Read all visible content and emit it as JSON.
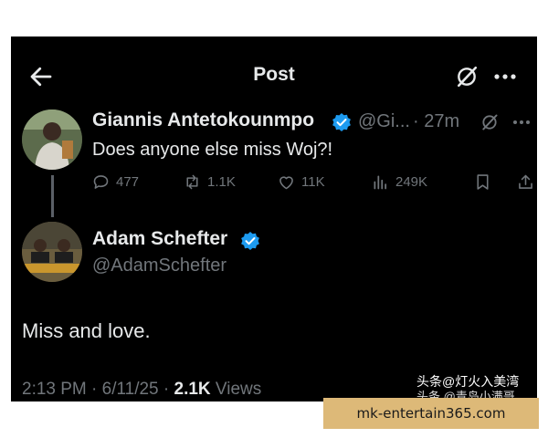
{
  "header": {
    "title": "Post",
    "back_icon": "arrow-left-icon",
    "grok_icon": "grok-icon",
    "more_icon": "more-horizontal-icon"
  },
  "original_post": {
    "author_name": "Giannis Antetokounmpo",
    "handle": "@Gi...",
    "time": "· 27m",
    "text": "Does anyone else miss Woj?!",
    "actions": {
      "replies": "477",
      "reposts": "1.1K",
      "likes": "11K",
      "views": "249K"
    }
  },
  "reply_post": {
    "author_name": "Adam Schefter",
    "handle": "@AdamSchefter",
    "text": "Miss and love.",
    "timestamp": "2:13 PM · 6/11/25 · ",
    "views_count": "2.1K",
    "views_label": " Views"
  },
  "watermark": {
    "line1": "头条@灯火入美湾",
    "line2": "头条 @青岛小满哥",
    "ad_text": "mk-entertain365.com"
  },
  "colors": {
    "background": "#000000",
    "text_primary": "#e7e9ea",
    "text_secondary": "#71767b",
    "verified_blue": "#1d9bf0",
    "ad_bar": "#ddb978"
  }
}
